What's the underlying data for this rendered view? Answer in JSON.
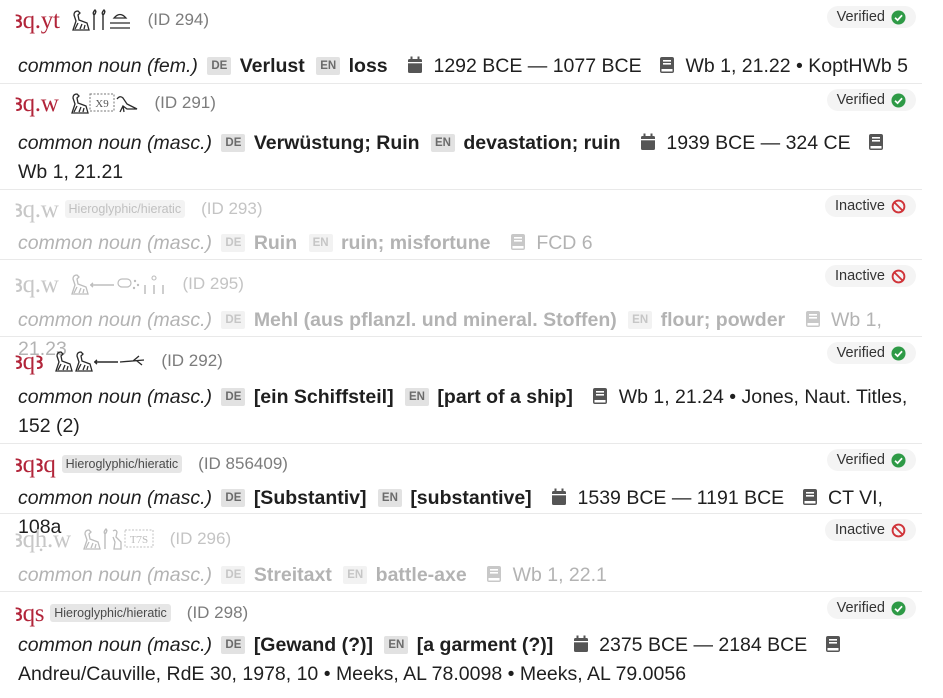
{
  "colors": {
    "translit": "#b2253a",
    "verified": "#2e9a46",
    "inactive": "#d0343a"
  },
  "entries": [
    {
      "translit": "ꜣq.yt",
      "hieroglyph_tag": "",
      "id": "(ID 294)",
      "status": "Verified",
      "pos": "common noun (fem.)",
      "de_tag": "DE",
      "de": "Verlust",
      "en_tag": "EN",
      "en": "loss",
      "dates": "1292 BCE — 1077 BCE",
      "bib": "Wb 1, 21.22 • KoptHWb 5",
      "glyph_icons": [
        "vulture-glyph",
        "reed-glyph",
        "reed-glyph",
        "loaf-glyph",
        "water-glyph"
      ]
    },
    {
      "translit": "ꜣq.w",
      "hieroglyph_tag": "",
      "id": "(ID 291)",
      "status": "Verified",
      "pos": "common noun (masc.)",
      "de_tag": "DE",
      "de": "Verwüstung; Ruin",
      "en_tag": "EN",
      "en": "devastation; ruin",
      "dates": "1939 BCE — 324 CE",
      "bib": "Wb 1, 21.21",
      "unknown_glyph_code": "X9",
      "glyph_icons": [
        "vulture-glyph",
        "unknown-glyph",
        "bird-glyph"
      ]
    },
    {
      "translit": "ꜣq.w",
      "hieroglyph_tag": "Hieroglyphic/hieratic",
      "id": "(ID 293)",
      "status": "Inactive",
      "pos": "common noun (masc.)",
      "de_tag": "DE",
      "de": "Ruin",
      "en_tag": "EN",
      "en": "ruin; misfortune",
      "dates": "",
      "bib": "FCD 6"
    },
    {
      "translit": "ꜣq.w",
      "hieroglyph_tag": "",
      "id": "(ID 295)",
      "status": "Inactive",
      "pos": "common noun (masc.)",
      "de_tag": "DE",
      "de": "Mehl (aus pflanzl. und mineral. Stoffen)",
      "en_tag": "EN",
      "en": "flour; powder",
      "dates": "",
      "bib": "Wb 1, 21.23",
      "glyph_icons": [
        "vulture-glyph",
        "stick-glyph",
        "grain-glyph",
        "plural-strokes-glyph"
      ]
    },
    {
      "translit": "ꜣqꜣ",
      "hieroglyph_tag": "",
      "id": "(ID 292)",
      "status": "Verified",
      "pos": "common noun (masc.)",
      "de_tag": "DE",
      "de": "[ein Schiffsteil]",
      "en_tag": "EN",
      "en": "[part of a ship]",
      "dates": "",
      "bib": "Wb 1, 21.24 • Jones, Naut. Titles, 152 (2)",
      "glyph_icons": [
        "vulture-glyph",
        "vulture-glyph",
        "stick-glyph",
        "rope-glyph"
      ]
    },
    {
      "translit": "ꜣqꜣq",
      "hieroglyph_tag": "Hieroglyphic/hieratic",
      "id": "(ID 856409)",
      "status": "Verified",
      "pos": "common noun (masc.)",
      "de_tag": "DE",
      "de": "[Substantiv]",
      "en_tag": "EN",
      "en": "[substantive]",
      "dates": "1539 BCE — 1191 BCE",
      "bib": "CT VI, 108a"
    },
    {
      "translit": "ꜣqḥ.w",
      "hieroglyph_tag": "",
      "id": "(ID 296)",
      "status": "Inactive",
      "pos": "common noun (masc.)",
      "de_tag": "DE",
      "de": "Streitaxt",
      "en_tag": "EN",
      "en": "battle-axe",
      "dates": "",
      "bib": "Wb 1, 22.1",
      "unknown_glyph_code": "T7S",
      "glyph_icons": [
        "vulture-glyph",
        "reed-glyph",
        "bird-glyph",
        "unknown-glyph"
      ]
    },
    {
      "translit": "ꜣqs",
      "hieroglyph_tag": "Hieroglyphic/hieratic",
      "id": "(ID 298)",
      "status": "Verified",
      "pos": "common noun (masc.)",
      "de_tag": "DE",
      "de": "[Gewand (?)]",
      "en_tag": "EN",
      "en": "[a garment (?)]",
      "dates": "2375 BCE — 2184 BCE",
      "bib": "Andreu/Cauville, RdE 30, 1978, 10 • Meeks, AL 78.0098 • Meeks, AL 79.0056"
    }
  ]
}
